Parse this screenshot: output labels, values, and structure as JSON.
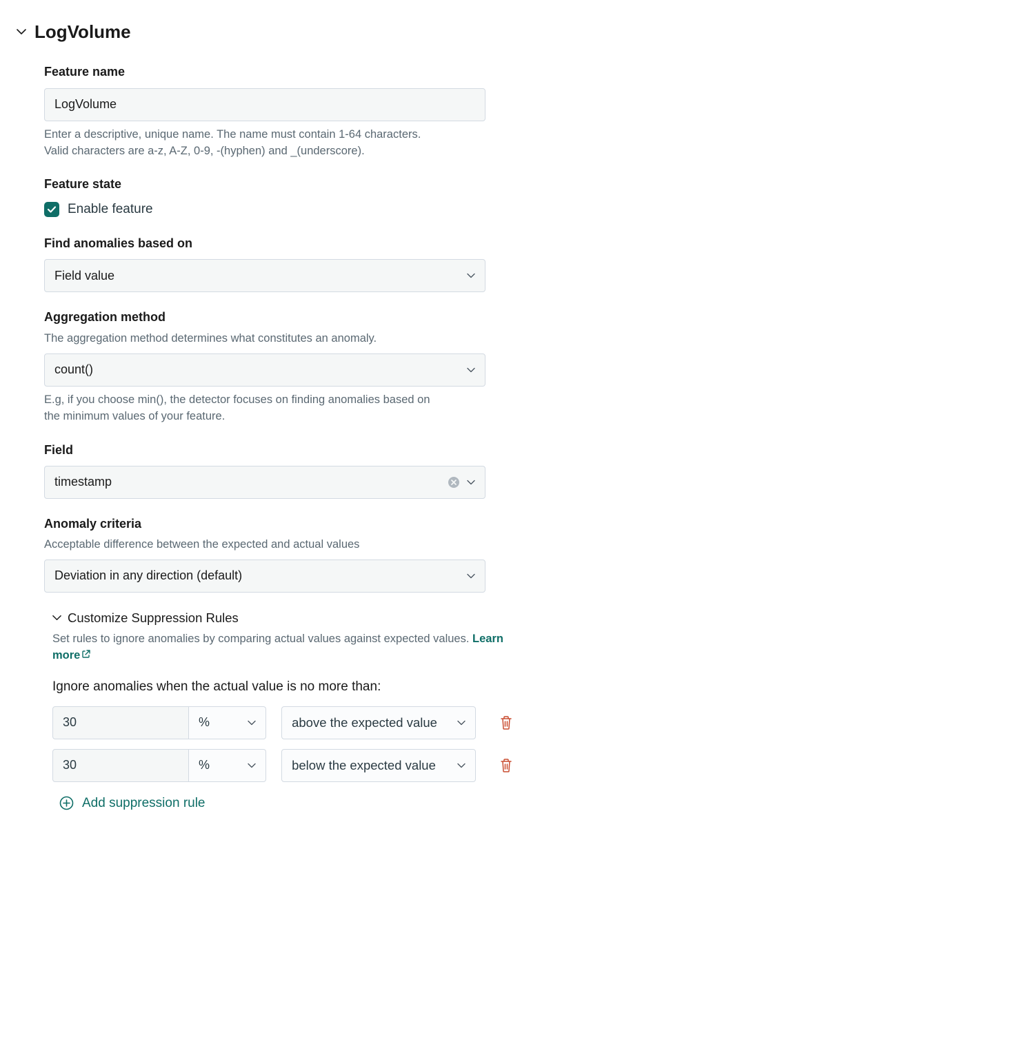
{
  "section_title": "LogVolume",
  "feature_name": {
    "label": "Feature name",
    "value": "LogVolume",
    "help": "Enter a descriptive, unique name. The name must contain 1-64 characters. Valid characters are a-z, A-Z, 0-9, -(hyphen) and _(underscore)."
  },
  "feature_state": {
    "label": "Feature state",
    "checkbox_label": "Enable feature",
    "checked": true
  },
  "anomalies_based_on": {
    "label": "Find anomalies based on",
    "value": "Field value"
  },
  "aggregation": {
    "label": "Aggregation method",
    "sublabel": "The aggregation method determines what constitutes an anomaly.",
    "value": "count()",
    "help": "E.g, if you choose min(), the detector focuses on finding anomalies based on the minimum values of your feature."
  },
  "field": {
    "label": "Field",
    "value": "timestamp"
  },
  "criteria": {
    "label": "Anomaly criteria",
    "sublabel": "Acceptable difference between the expected and actual values",
    "value": "Deviation in any direction (default)"
  },
  "suppression": {
    "title": "Customize Suppression Rules",
    "desc": "Set rules to ignore anomalies by comparing actual values against expected values. ",
    "learn_more": "Learn more",
    "rules_label": "Ignore anomalies when the actual value is no more than:",
    "rules": [
      {
        "value": "30",
        "unit": "%",
        "direction": "above the expected value"
      },
      {
        "value": "30",
        "unit": "%",
        "direction": "below the expected value"
      }
    ],
    "add_label": "Add suppression rule"
  }
}
